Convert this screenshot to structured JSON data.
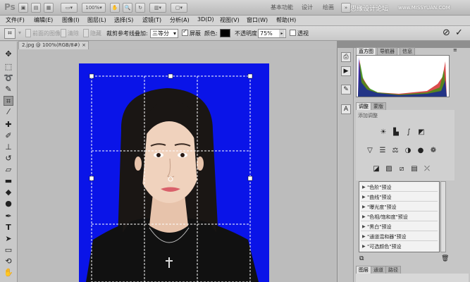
{
  "titlebar": {
    "app_icon": "Ps",
    "zoom": "100%",
    "workspaces": [
      "基本功能",
      "设计",
      "绘画"
    ],
    "watermark": "思缘设计论坛",
    "watermark_url": "www.MISSYUAN.COM"
  },
  "menu": [
    "文件(F)",
    "编辑(E)",
    "图像(I)",
    "图层(L)",
    "选择(S)",
    "滤镜(T)",
    "分析(A)",
    "3D(D)",
    "视图(V)",
    "窗口(W)",
    "帮助(H)"
  ],
  "options": {
    "front_image": "前面的图像",
    "clear": "清除",
    "hide": "隐藏",
    "overlay_label": "裁剪参考线叠加:",
    "overlay_value": "三等分",
    "shield_label": "屏蔽",
    "color_label": "颜色:",
    "opacity_label": "不透明度:",
    "opacity_value": "75%",
    "perspective_label": "透视"
  },
  "document": {
    "tab": "2.jpg @ 100%(RGB/8#)"
  },
  "panels": {
    "top_tabs": [
      "直方图",
      "导航器",
      "信息"
    ],
    "adjust_tabs": [
      "调整",
      "蒙版"
    ],
    "add_adjustment": "添加调整",
    "presets": [
      "\"色阶\"预设",
      "\"曲线\"预设",
      "\"曝光度\"预设",
      "\"色相/饱和度\"预设",
      "\"黑白\"预设",
      "\"通道混和器\"预设",
      "\"可选颜色\"预设"
    ],
    "bottom_tabs": [
      "图层",
      "通道",
      "路径"
    ]
  },
  "colors": {
    "photo_background": "#0a14e8",
    "ui_gray": "#c6c6c6"
  }
}
